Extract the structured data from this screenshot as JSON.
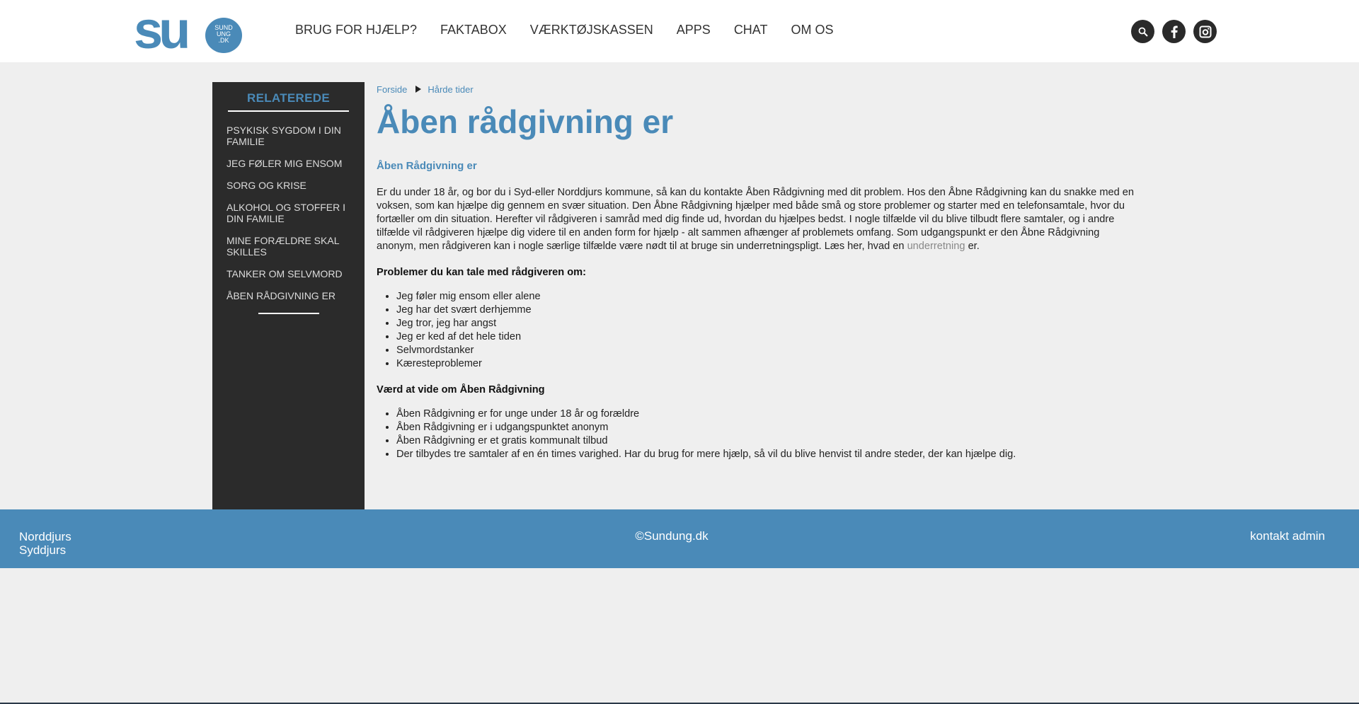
{
  "logo": {
    "mark": "su",
    "bubble_text": "SUND\nUNG\n.DK"
  },
  "nav": {
    "items": [
      "BRUG FOR HJÆLP?",
      "FAKTABOX",
      "VÆRKTØJSKASSEN",
      "APPS",
      "CHAT",
      "OM OS"
    ]
  },
  "social": {
    "icons": [
      "search-icon",
      "facebook-icon",
      "instagram-icon"
    ]
  },
  "sidebar": {
    "title": "RELATEREDE",
    "items": [
      "PSYKISK SYGDOM I DIN FAMILIE",
      "JEG FØLER MIG ENSOM",
      "SORG OG KRISE",
      "ALKOHOL OG STOFFER I DIN FAMILIE",
      "MINE FORÆLDRE SKAL SKILLES",
      "TANKER OM SELVMORD",
      "ÅBEN RÅDGIVNING ER"
    ]
  },
  "breadcrumb": {
    "home": "Forside",
    "current": "Hårde tider"
  },
  "main": {
    "title": "Åben rådgivning er",
    "subtitle": "Åben Rådgivning er",
    "intro_part1": "Er du under 18 år, og bor du i Syd-eller Norddjurs kommune, så kan du kontakte Åben Rådgivning med dit problem. Hos den Åbne Rådgivning kan du snakke med en voksen, som kan hjælpe dig gennem en svær situation. Den Åbne Rådgivning hjælper med både små og store problemer og starter med en telefonsamtale, hvor du fortæller om din situation. Herefter vil rådgiveren i samråd med dig finde ud, hvordan du hjælpes bedst. I nogle tilfælde vil du blive tilbudt flere samtaler, og i andre tilfælde vil rådgiveren hjælpe dig videre til en anden form for hjælp - alt sammen afhænger af problemets omfang. Som udgangspunkt er den Åbne Rådgivning anonym, men rådgiveren kan i nogle særlige tilfælde være nødt til at bruge sin underretningspligt. Læs her, hvad en ",
    "intro_link": "underretning",
    "intro_part2": " er.",
    "problems_heading": "Problemer du kan tale med rådgiveren om:",
    "problems": [
      "Jeg føler mig ensom eller alene",
      "Jeg har det svært derhjemme",
      "Jeg tror, jeg har angst",
      "Jeg er ked af det hele tiden",
      "Selvmordstanker",
      "Kæresteproblemer"
    ],
    "facts_heading": "Værd at vide om Åben Rådgivning",
    "facts": [
      "Åben Rådgivning er for unge under 18 år og forældre",
      "Åben Rådgivning er i udgangspunktet anonym",
      "Åben Rådgivning er et gratis kommunalt tilbud",
      "Der tilbydes tre samtaler af en én times varighed. Har du brug for mere hjælp, så vil du blive henvist til andre steder, der kan hjælpe dig."
    ]
  },
  "footer": {
    "left_line1": "Norddjurs",
    "left_line2": "Syddjurs",
    "copyright": "©Sundung.dk",
    "contact": "kontakt admin"
  },
  "colors": {
    "accent": "#4a8ab8",
    "sidebar_bg": "#2b2b2b",
    "page_bg": "#efefef"
  }
}
